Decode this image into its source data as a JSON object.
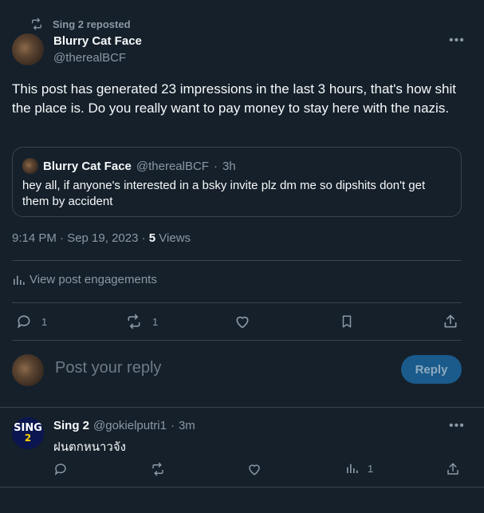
{
  "repost": {
    "text": "Sing 2 reposted"
  },
  "post": {
    "author_name": "Blurry Cat Face",
    "author_handle": "@therealBCF",
    "text": "This post has generated 23 impressions in the last 3 hours, that's how shit the place is. Do you really want to pay money to stay here with the nazis.",
    "quote": {
      "author_name": "Blurry Cat Face",
      "author_handle": "@therealBCF",
      "time": "3h",
      "text": "hey all, if anyone's interested in a bsky invite plz dm me so dipshits don't get them by accident"
    },
    "timestamp": "9:14 PM · Sep 19, 2023 · ",
    "views_count": "5",
    "views_label": " Views",
    "engagements_label": "View post engagements",
    "actions": {
      "reply_count": "1",
      "repost_count": "1"
    }
  },
  "reply_composer": {
    "placeholder": "Post your reply",
    "button_label": "Reply"
  },
  "reply": {
    "author_name": "Sing 2",
    "author_handle": "@gokielputri1",
    "time": "3m",
    "text": "ฝนตกหนาวจัง",
    "avatar_text_top": "SING",
    "avatar_text_bottom": "2",
    "actions": {
      "views_count": "1"
    }
  },
  "colors": {
    "background": "#15202b",
    "accent": "#1d9bf0",
    "muted": "#8b98a5",
    "border": "#38444d"
  }
}
